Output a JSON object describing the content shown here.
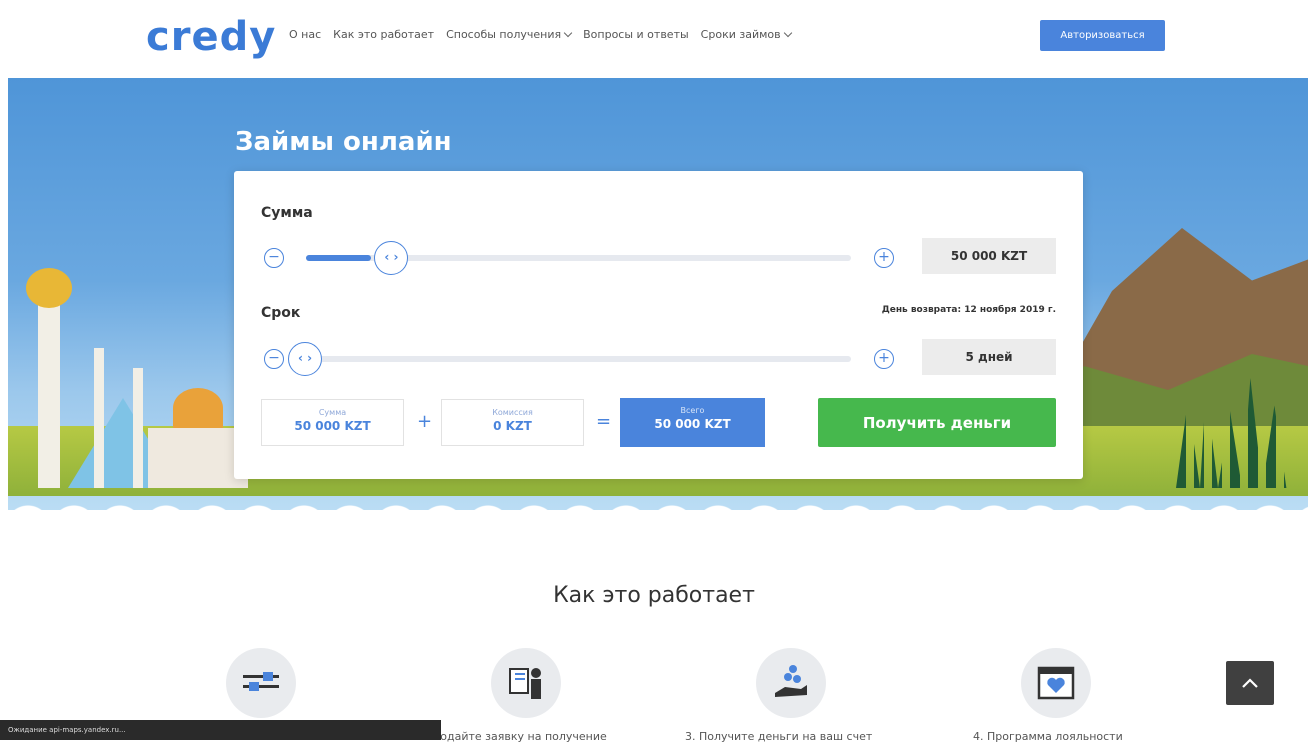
{
  "header": {
    "logo": "credy",
    "nav": [
      {
        "label": "О нас",
        "dropdown": false
      },
      {
        "label": "Как это работает",
        "dropdown": false
      },
      {
        "label": "Способы получения",
        "dropdown": true
      },
      {
        "label": "Вопросы и ответы",
        "dropdown": false
      },
      {
        "label": "Сроки займов",
        "dropdown": true
      }
    ],
    "login_label": "Авторизоваться"
  },
  "hero": {
    "title": "Займы онлайн"
  },
  "calculator": {
    "sum_label": "Сумма",
    "sum_value": "50 000 KZT",
    "sum_slider_fraction": 0.12,
    "term_label": "Срок",
    "term_value": "5 дней",
    "term_slider_fraction": 0.0,
    "return_date": "День возврата: 12 ноября 2019 г.",
    "knob_glyph": "‹ ›",
    "minus_glyph": "−",
    "plus_glyph": "+",
    "summary": {
      "amount_label": "Сумма",
      "amount_value": "50 000 KZT",
      "plus": "+",
      "fee_label": "Комиссия",
      "fee_value": "0 KZT",
      "equals": "=",
      "total_label": "Всего",
      "total_value": "50 000 KZT"
    },
    "get_money_label": "Получить деньги"
  },
  "how_it_works": {
    "title": "Как это работает",
    "steps": [
      {
        "text": ""
      },
      {
        "text": "Подайте заявку на получение"
      },
      {
        "text": "3. Получите деньги на ваш счет"
      },
      {
        "text": "4. Программа лояльности"
      }
    ]
  },
  "status_bar": "Ожидание api-maps.yandex.ru...",
  "colors": {
    "accent": "#4a84dc",
    "cta": "#46b84d"
  }
}
